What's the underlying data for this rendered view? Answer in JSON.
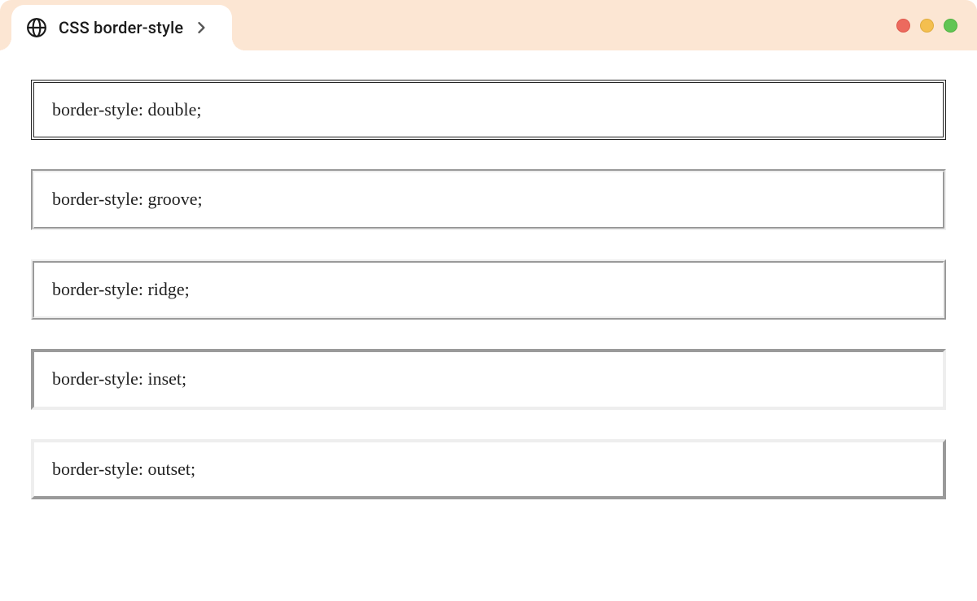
{
  "tab": {
    "title": "CSS border-style"
  },
  "examples": [
    {
      "style": "double",
      "label": "border-style: double;"
    },
    {
      "style": "groove",
      "label": "border-style: groove;"
    },
    {
      "style": "ridge",
      "label": "border-style: ridge;"
    },
    {
      "style": "inset",
      "label": "border-style: inset;"
    },
    {
      "style": "outset",
      "label": "border-style: outset;"
    }
  ]
}
